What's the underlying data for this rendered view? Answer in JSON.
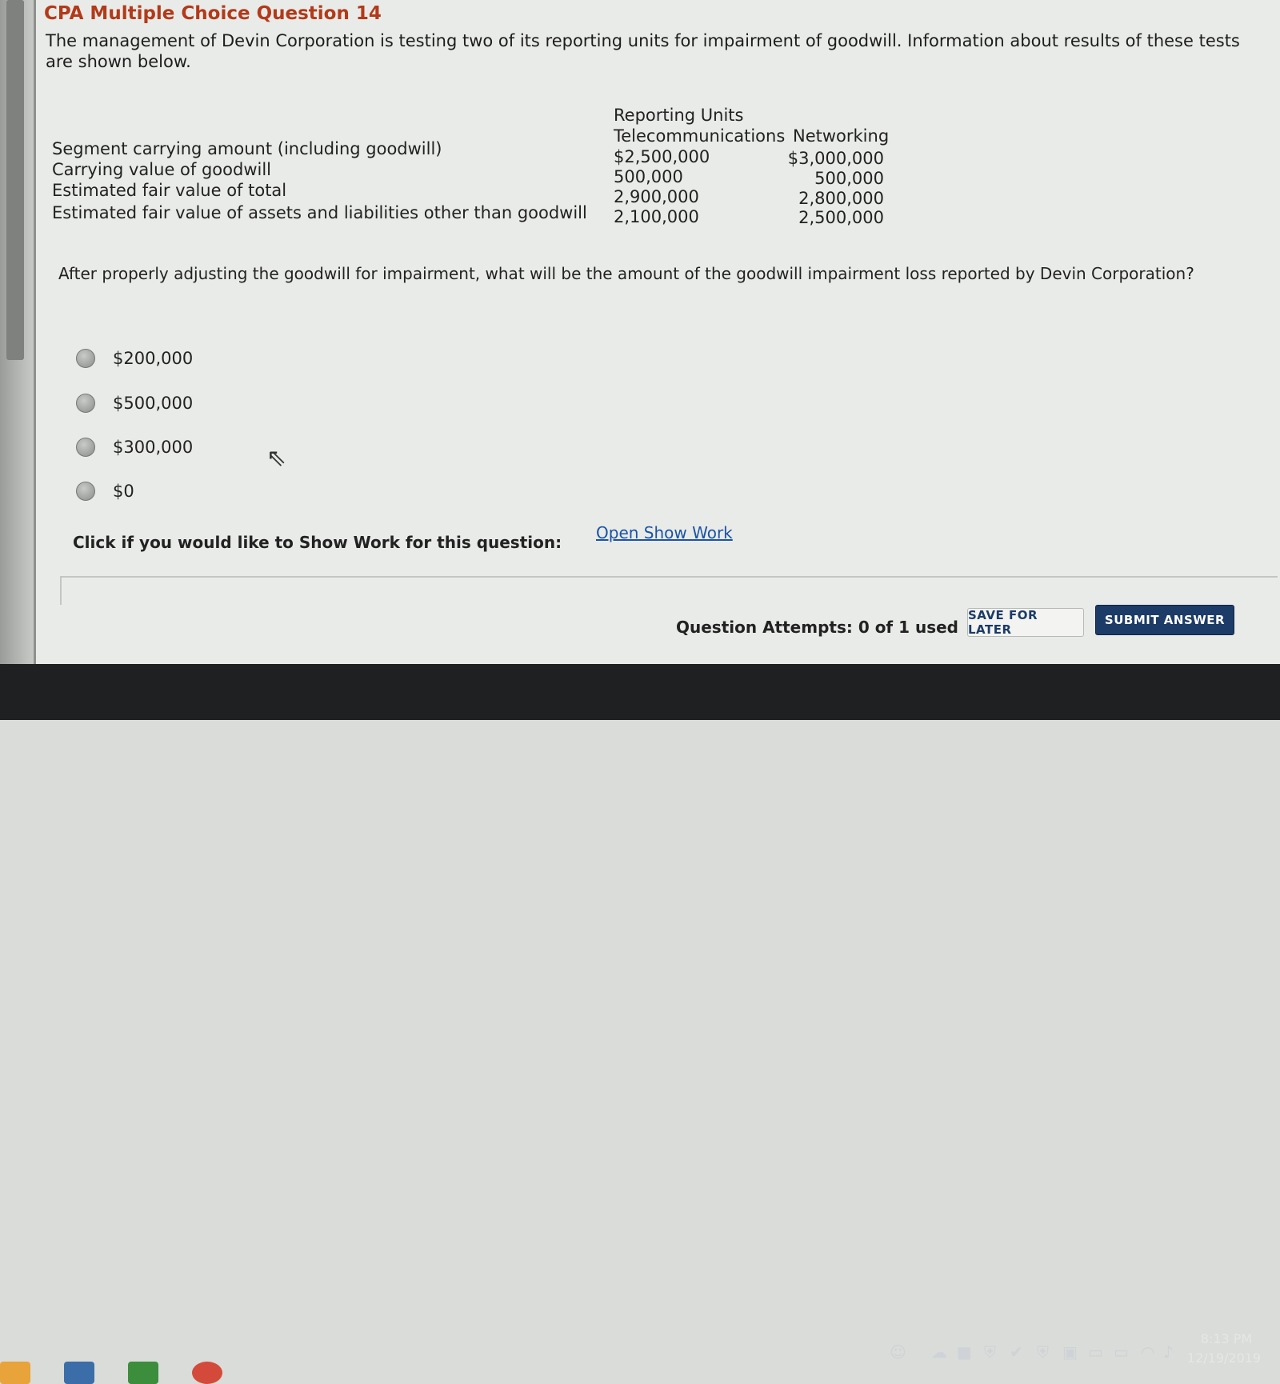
{
  "question": {
    "title": "CPA Multiple Choice Question 14",
    "intro": "The management of Devin Corporation is testing two of its reporting units for impairment of goodwill. Information about results of these tests are shown below.",
    "units_header": "Reporting Units",
    "columns": [
      "Telecommunications",
      "Networking"
    ],
    "rows": [
      {
        "label": "Segment carrying amount (including goodwill)",
        "telecom": "$2,500,000",
        "networking": "$3,000,000"
      },
      {
        "label": "Carrying value of goodwill",
        "telecom": "500,000",
        "networking": "500,000"
      },
      {
        "label": "Estimated fair value of total",
        "telecom": "2,900,000",
        "networking": "2,800,000"
      },
      {
        "label": "Estimated fair value of assets and liabilities other than goodwill",
        "telecom": "2,100,000",
        "networking": "2,500,000"
      }
    ],
    "prompt": "After properly adjusting the goodwill for impairment, what will be the amount of the goodwill impairment loss reported by Devin Corporation?",
    "options": [
      "$200,000",
      "$500,000",
      "$300,000",
      "$0"
    ]
  },
  "show_work": {
    "label": "Click if you would like to Show Work for this question:",
    "link": "Open Show Work"
  },
  "footer": {
    "attempts": "Question Attempts: 0 of 1 used",
    "save_label": "SAVE FOR LATER",
    "submit_label": "SUBMIT ANSWER"
  },
  "taskbar": {
    "time": "8:13 PM",
    "date": "12/19/2019"
  }
}
